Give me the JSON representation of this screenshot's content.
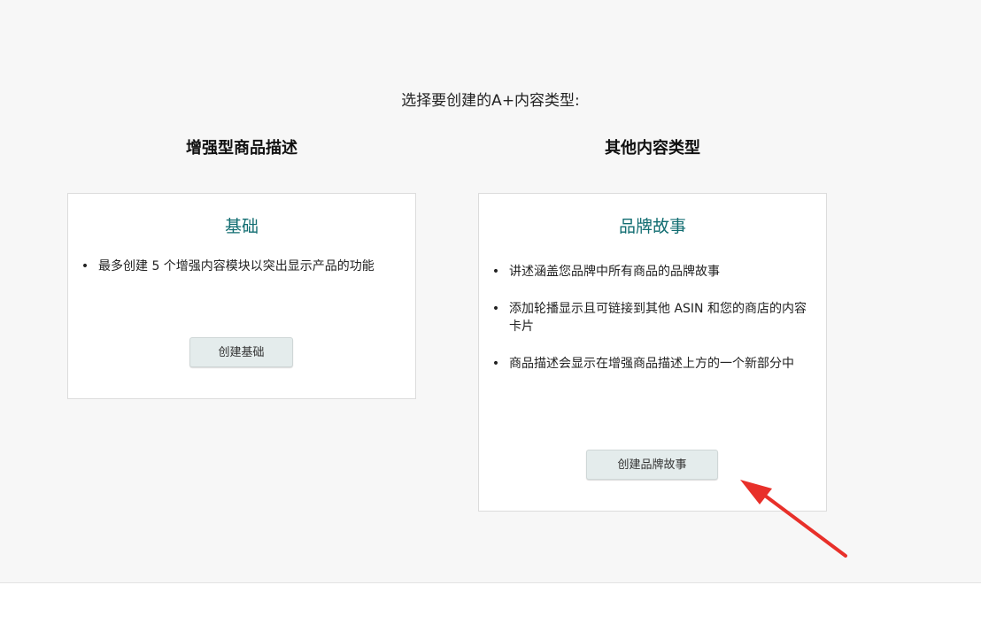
{
  "page": {
    "title": "选择要创建的A+内容类型:"
  },
  "columns": {
    "left_heading": "增强型商品描述",
    "right_heading": "其他内容类型"
  },
  "cards": {
    "basic": {
      "title": "基础",
      "features": [
        "最多创建 5 个增强内容模块以突出显示产品的功能"
      ],
      "button_label": "创建基础"
    },
    "brand_story": {
      "title": "品牌故事",
      "features": [
        "讲述涵盖您品牌中所有商品的品牌故事",
        "添加轮播显示且可链接到其他 ASIN 和您的商店的内容卡片",
        "商品描述会显示在增强商品描述上方的一个新部分中"
      ],
      "button_label": "创建品牌故事"
    }
  },
  "colors": {
    "card_title": "#116d71",
    "annotation_arrow": "#e8302a",
    "button_bg": "#e4ecec"
  }
}
